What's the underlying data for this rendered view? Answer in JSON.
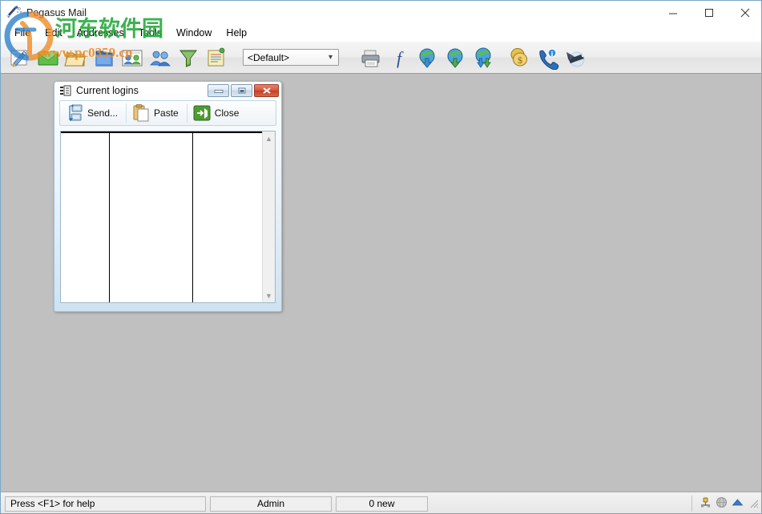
{
  "window": {
    "title": "Pegasus Mail",
    "app_icon": "pegasus-mail-icon",
    "controls": {
      "minimize": "minimize-icon",
      "maximize": "maximize-icon",
      "close": "close-icon"
    }
  },
  "menubar": {
    "items": [
      {
        "label": "File"
      },
      {
        "label": "Edit"
      },
      {
        "label": "Addresses"
      },
      {
        "label": "Tools"
      },
      {
        "label": "Window"
      },
      {
        "label": "Help"
      }
    ]
  },
  "toolbar": {
    "buttons": [
      {
        "name": "new-message-icon",
        "tooltip": "New message"
      },
      {
        "name": "read-mail-icon",
        "tooltip": "Read new mail"
      },
      {
        "name": "folders-icon",
        "tooltip": "Mail folders"
      },
      {
        "name": "blue-folder-icon",
        "tooltip": "Open folder"
      },
      {
        "name": "distribution-lists-icon",
        "tooltip": "Distribution lists"
      },
      {
        "name": "address-book-icon",
        "tooltip": "Address books"
      },
      {
        "name": "filter-funnel-icon",
        "tooltip": "Mail filtering rules"
      },
      {
        "name": "notepad-icon",
        "tooltip": "Notepad"
      }
    ],
    "identity_select": {
      "value": "<Default>",
      "arrow": "chevron-down-icon"
    },
    "buttons_right": [
      {
        "name": "print-icon",
        "tooltip": "Print"
      },
      {
        "name": "font-icon",
        "tooltip": "Fonts"
      },
      {
        "name": "send-mail-icon",
        "tooltip": "Send all mail"
      },
      {
        "name": "check-mail-icon",
        "tooltip": "Check host for new mail"
      },
      {
        "name": "send-receive-icon",
        "tooltip": "Send and receive mail"
      },
      {
        "name": "coins-icon",
        "tooltip": "Registration"
      },
      {
        "name": "support-phone-icon",
        "tooltip": "Support"
      },
      {
        "name": "pegasus-bird-icon",
        "tooltip": "About Pegasus Mail"
      }
    ]
  },
  "child_window": {
    "title": "Current logins",
    "icon": "login-list-icon",
    "controls": {
      "minimize": "minimize-icon",
      "restore": "restore-icon",
      "close": "close-icon"
    },
    "toolbar": [
      {
        "label": "Send...",
        "icon": "send-network-icon"
      },
      {
        "label": "Paste",
        "icon": "paste-clipboard-icon"
      },
      {
        "label": "Close",
        "icon": "exit-door-icon"
      }
    ],
    "list": {
      "rows": [],
      "column_dividers": [
        60,
        164
      ],
      "scrollbar": {
        "up": "chevron-up-icon",
        "down": "chevron-down-icon"
      }
    }
  },
  "statusbar": {
    "help_text": "Press <F1> for help",
    "user": "Admin",
    "new_count": "0 new",
    "icons": [
      {
        "name": "network-connector-icon"
      },
      {
        "name": "globe-offline-icon"
      },
      {
        "name": "blue-triangle-icon"
      }
    ],
    "grip": "resize-grip-icon"
  },
  "watermark": {
    "site_name": "河东软件园",
    "site_url": "www.pc0359.cn",
    "colors": {
      "green": "#22a838",
      "orange": "#f08a1e",
      "blue": "#2a7fc9"
    }
  }
}
